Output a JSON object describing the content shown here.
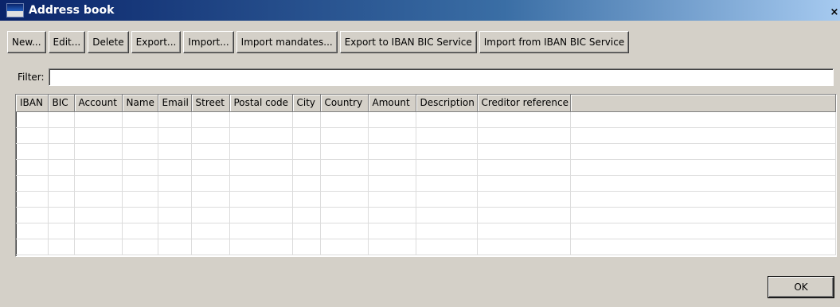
{
  "window": {
    "title": "Address book",
    "close_glyph": "×"
  },
  "toolbar": {
    "buttons": [
      {
        "label": "New..."
      },
      {
        "label": "Edit..."
      },
      {
        "label": "Delete"
      },
      {
        "label": "Export..."
      },
      {
        "label": "Import..."
      },
      {
        "label": "Import mandates..."
      },
      {
        "label": "Export to IBAN BIC Service"
      },
      {
        "label": "Import from IBAN BIC Service"
      }
    ]
  },
  "filter": {
    "label": "Filter:",
    "value": ""
  },
  "table": {
    "columns": [
      {
        "label": "IBAN"
      },
      {
        "label": "BIC"
      },
      {
        "label": "Account"
      },
      {
        "label": "Name"
      },
      {
        "label": "Email"
      },
      {
        "label": "Street"
      },
      {
        "label": "Postal code"
      },
      {
        "label": "City"
      },
      {
        "label": "Country"
      },
      {
        "label": "Amount"
      },
      {
        "label": "Description"
      },
      {
        "label": "Creditor reference"
      }
    ],
    "rows": []
  },
  "footer": {
    "ok_label": "OK"
  }
}
